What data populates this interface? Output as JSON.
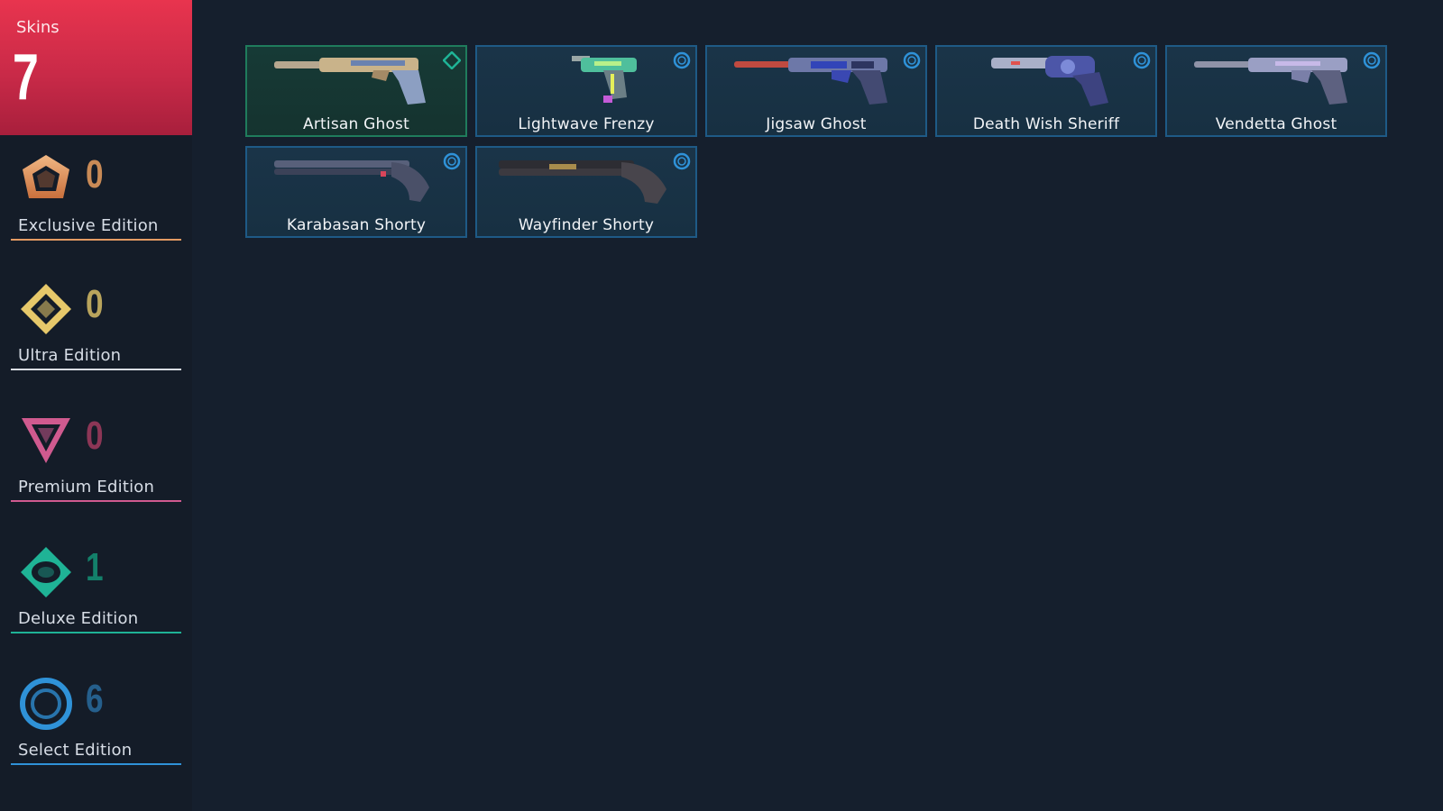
{
  "summary": {
    "label": "Skins",
    "total": "7",
    "accent": "#e8344e"
  },
  "tiers": [
    {
      "name": "Exclusive Edition",
      "count": "0",
      "color": "#e39a63",
      "icon": "exclusive-edition-icon"
    },
    {
      "name": "Ultra Edition",
      "count": "0",
      "color": "#e6c86a",
      "icon": "ultra-edition-icon"
    },
    {
      "name": "Premium Edition",
      "count": "0",
      "color": "#d05a8f",
      "icon": "premium-edition-icon"
    },
    {
      "name": "Deluxe Edition",
      "count": "1",
      "color": "#1fb396",
      "icon": "deluxe-edition-icon"
    },
    {
      "name": "Select Edition",
      "count": "6",
      "color": "#2f92d8",
      "icon": "select-edition-icon"
    }
  ],
  "skins": [
    {
      "name": "Artisan Ghost",
      "tier": "deluxe"
    },
    {
      "name": "Lightwave Frenzy",
      "tier": "select"
    },
    {
      "name": "Jigsaw Ghost",
      "tier": "select"
    },
    {
      "name": "Death Wish Sheriff",
      "tier": "select"
    },
    {
      "name": "Vendetta Ghost",
      "tier": "select"
    },
    {
      "name": "Karabasan Shorty",
      "tier": "select"
    },
    {
      "name": "Wayfinder Shorty",
      "tier": "select"
    }
  ]
}
